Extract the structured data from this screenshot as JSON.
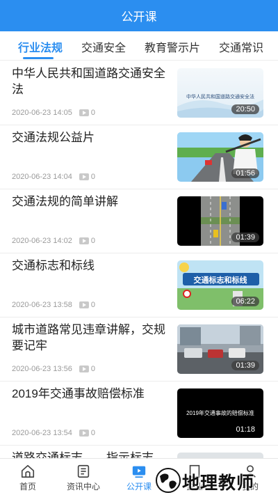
{
  "header": {
    "title": "公开课"
  },
  "tabs": [
    {
      "label": "行业法规",
      "active": true
    },
    {
      "label": "交通安全"
    },
    {
      "label": "教育警示片"
    },
    {
      "label": "交通常识"
    }
  ],
  "items": [
    {
      "title": "中华人民共和国道路交通安全法",
      "date": "2020-06-23 14:05",
      "views": "0",
      "duration": "20:50",
      "thumb_caption": "中华人民共和国道路交通安全法"
    },
    {
      "title": "交通法规公益片",
      "date": "2020-06-23 14:04",
      "views": "0",
      "duration": "01:56"
    },
    {
      "title": "交通法规的简单讲解",
      "date": "2020-06-23 14:02",
      "views": "0",
      "duration": "01:39"
    },
    {
      "title": "交通标志和标线",
      "date": "2020-06-23 13:58",
      "views": "0",
      "duration": "06:22",
      "thumb_caption": "交通标志和标线"
    },
    {
      "title": "城市道路常见违章讲解，交规要记牢",
      "date": "2020-06-23 13:56",
      "views": "0",
      "duration": "01:39"
    },
    {
      "title": "2019年交通事故赔偿标准",
      "date": "2020-06-23 13:54",
      "views": "0",
      "duration": "01:18",
      "thumb_caption": "2019年交通事故的赔偿标准"
    },
    {
      "title": "道路交通标志——指示标志"
    }
  ],
  "bottom_nav": [
    {
      "label": "首页",
      "icon": "home-icon"
    },
    {
      "label": "资讯中心",
      "icon": "news-icon"
    },
    {
      "label": "公开课",
      "icon": "video-icon",
      "active": true
    },
    {
      "label": "企业",
      "icon": "enterprise-icon"
    },
    {
      "label": "我的",
      "icon": "user-icon"
    }
  ],
  "watermark": {
    "text": "地理教师"
  },
  "colors": {
    "primary": "#2b8ef0",
    "divider": "#ececec",
    "meta_text": "#9a9a9a"
  }
}
